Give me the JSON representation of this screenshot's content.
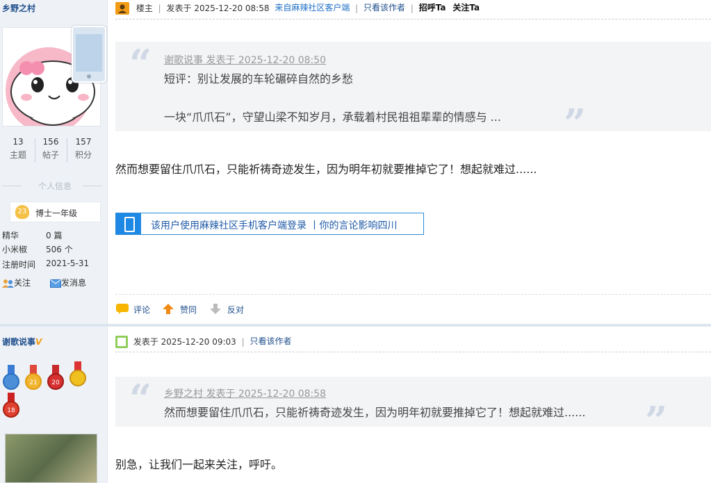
{
  "post1": {
    "author": {
      "name": "乡野之村",
      "stats": [
        {
          "value": "13",
          "label": "主题"
        },
        {
          "value": "156",
          "label": "帖子"
        },
        {
          "value": "157",
          "label": "积分"
        }
      ],
      "section_title": "个人信息",
      "level_badge": "23",
      "level_name": "博士一年级",
      "details": [
        {
          "key": "精华",
          "value": "0 篇"
        },
        {
          "key": "小米椒",
          "value": "506 个"
        },
        {
          "key": "注册时间",
          "value": "2021-5-31"
        }
      ],
      "actions": {
        "follow": "关注",
        "message": "发消息"
      }
    },
    "header": {
      "floor": "楼主",
      "posted": "发表于 2025-12-20 08:58",
      "source": "来自麻辣社区客户端",
      "only_author": "只看该作者",
      "greet": "招呼Ta",
      "follow": "关注Ta"
    },
    "quote": {
      "attribution": "谢歌说事 发表于 2025-12-20 08:50",
      "line1": "短评：别让发展的车轮碾碎自然的乡愁",
      "line2": "一块“爪爪石”，守望山梁不知岁月，承载着村民祖祖辈辈的情感与 ..."
    },
    "body": "然而想要留住爪爪石，只能祈祷奇迹发生，因为明年初就要推掉它了！想起就难过......",
    "client_banner": "该用户使用麻辣社区手机客户端登录 丨你的言论影响四川",
    "footer": {
      "comment": "评论",
      "like": "赞同",
      "dislike": "反对"
    }
  },
  "post2": {
    "author": {
      "name": "谢歌说事",
      "verified": "V",
      "medals": [
        "",
        "21",
        "20",
        "",
        "18"
      ]
    },
    "header": {
      "posted": "发表于 2025-12-20 09:03",
      "only_author": "只看该作者"
    },
    "quote": {
      "attribution": "乡野之村 发表于 2025-12-20 08:58",
      "line1": "然而想要留住爪爪石，只能祈祷奇迹发生，因为明年初就要推掉它了！想起就难过......"
    },
    "body": "别急，让我们一起来关注，呼吁。"
  },
  "colors": {
    "link": "#1f4e8c",
    "sidebar_bg": "#eef2f6",
    "quote_bg": "#f3f4f6",
    "accent_blue": "#1e88e5"
  }
}
